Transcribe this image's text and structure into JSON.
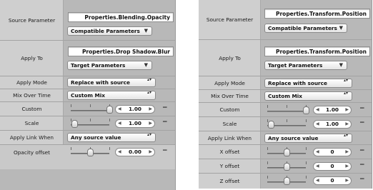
{
  "left_panel": {
    "source_parameter": {
      "label": "Source Parameter",
      "value": "Properties.Blending.Opacity",
      "menu": "Compatible Parameters"
    },
    "apply_to": {
      "label": "Apply To",
      "value": "Properties.Drop Shadow.Blur",
      "menu": "Target Parameters"
    },
    "apply_mode": {
      "label": "Apply Mode",
      "value": "Replace with source"
    },
    "mix_over_time": {
      "label": "Mix Over Time",
      "value": "Custom Mix"
    },
    "custom": {
      "label": "Custom",
      "value": "1.00",
      "slider": 1.0
    },
    "scale": {
      "label": "Scale",
      "value": "1.00",
      "slider": 0.1
    },
    "apply_link_when": {
      "label": "Apply Link When",
      "value": "Any source value"
    },
    "opacity_offset": {
      "label": "Opacity offset",
      "value": "0.00",
      "slider": 0.5
    }
  },
  "right_panel": {
    "source_parameter": {
      "label": "Source Parameter",
      "value": "Properties.Transform.Position",
      "menu": "Compatible Parameters"
    },
    "apply_to": {
      "label": "Apply To",
      "value": "Properties.Transform.Position",
      "menu": "Target Parameters"
    },
    "apply_mode": {
      "label": "Apply Mode",
      "value": "Replace with source"
    },
    "mix_over_time": {
      "label": "Mix Over Time",
      "value": "Custom Mix"
    },
    "custom": {
      "label": "Custom",
      "value": "1.00",
      "slider": 1.0
    },
    "scale": {
      "label": "Scale",
      "value": "1.00",
      "slider": 0.1
    },
    "apply_link_when": {
      "label": "Apply Link When",
      "value": "Any source value"
    },
    "x_offset": {
      "label": "X offset",
      "value": "0",
      "slider": 0.5
    },
    "y_offset": {
      "label": "Y offset",
      "value": "0",
      "slider": 0.5
    },
    "z_offset": {
      "label": "Z offset",
      "value": "0",
      "slider": 0.5
    }
  },
  "icons": {
    "popup_arrow": "▼",
    "updown_arrow": "▴▾",
    "stepper_left": "◀",
    "stepper_right": "▶",
    "reset": "−"
  }
}
